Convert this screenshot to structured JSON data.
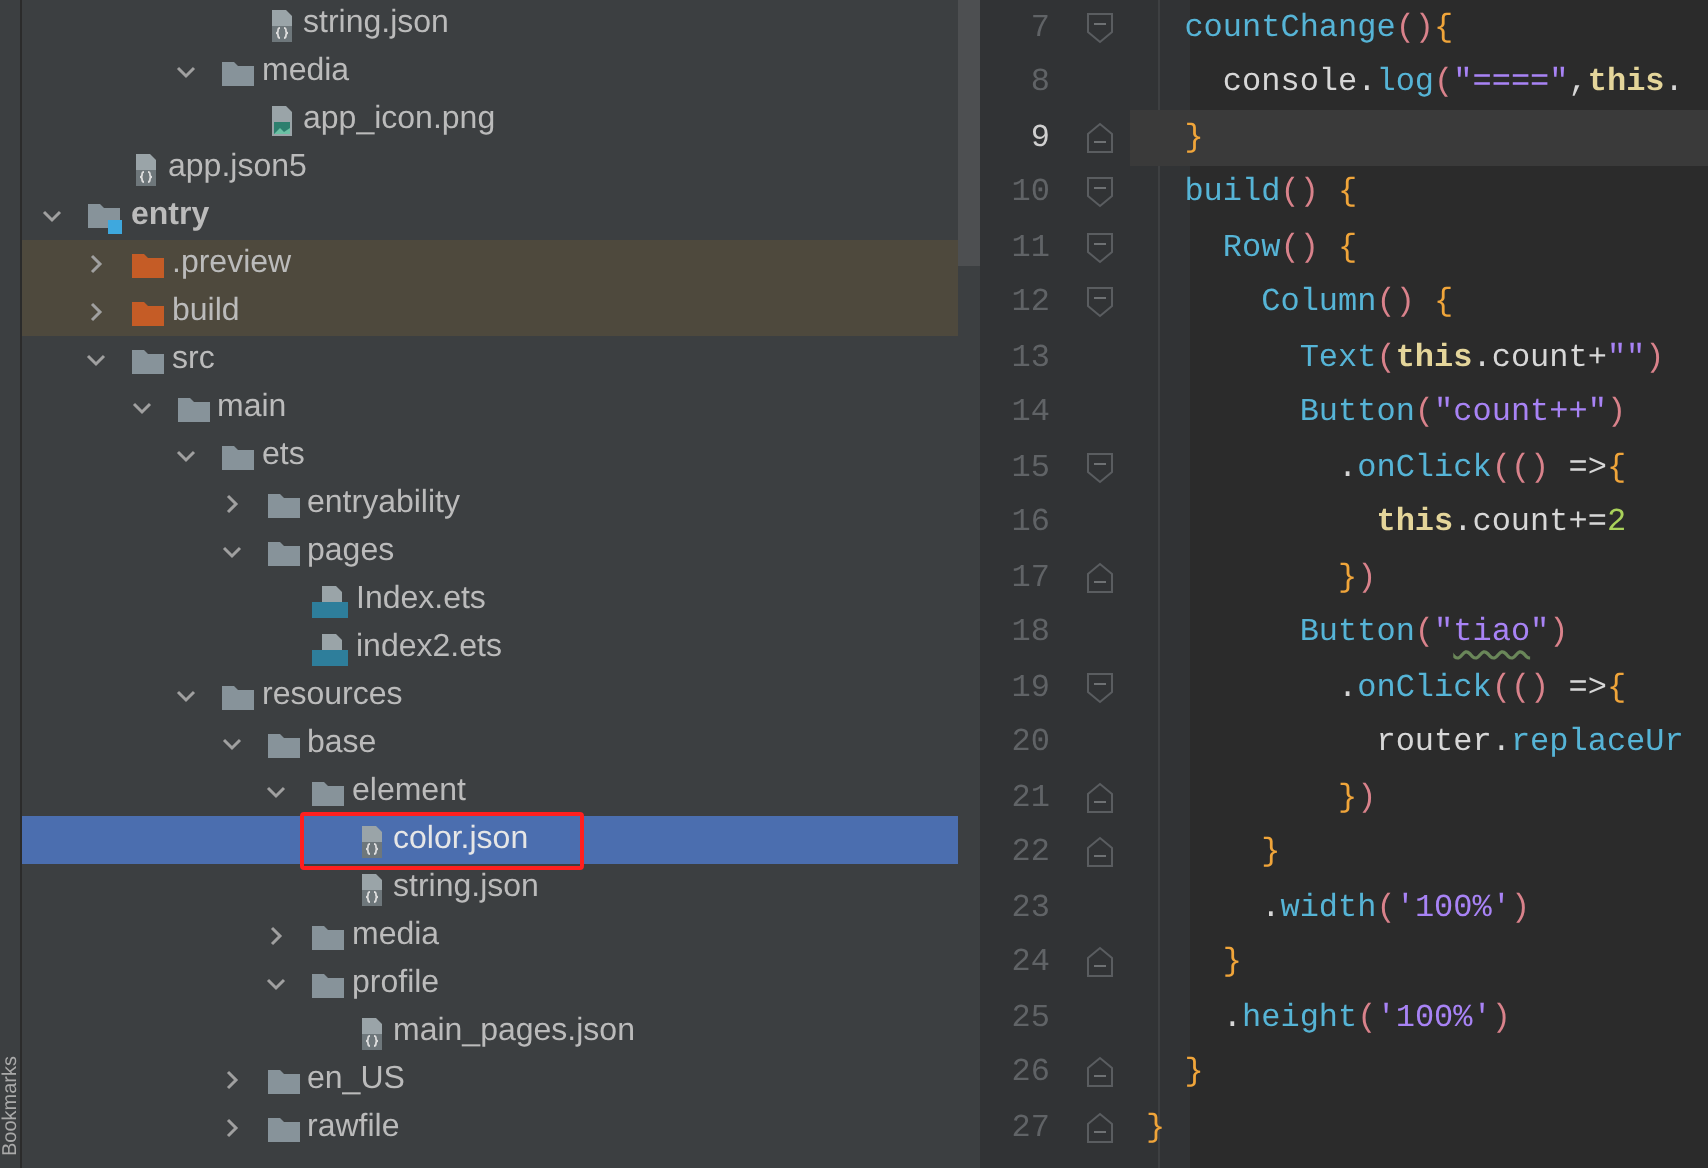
{
  "sidebar_strip": {
    "label": "Bookmarks"
  },
  "tree": [
    {
      "children": [
        {
          "children": [
            {
              "children": [
                {
                  "children": [
                    {
                      "label": "string.json",
                      "kind": "json",
                      "selected": false,
                      "annotated": false
                    }
                  ]
                },
                {
                  "label": "media",
                  "kind": "folder",
                  "expanded": true,
                  "selected": false,
                  "annotated": false,
                  "children": [
                    {
                      "label": "app_icon.png",
                      "kind": "image",
                      "selected": false,
                      "annotated": false
                    }
                  ]
                }
              ]
            }
          ]
        },
        {
          "label": "app.json5",
          "kind": "json",
          "selected": false,
          "annotated": false
        }
      ]
    },
    {
      "label": "entry",
      "kind": "module",
      "expanded": true,
      "selected": false,
      "annotated": false,
      "children": [
        {
          "label": ".preview",
          "kind": "excluded",
          "expanded": false,
          "selected": false,
          "annotated": false
        },
        {
          "label": "build",
          "kind": "excluded",
          "expanded": false,
          "selected": false,
          "annotated": false
        },
        {
          "label": "src",
          "kind": "folder",
          "expanded": true,
          "selected": false,
          "annotated": false,
          "children": [
            {
              "label": "main",
              "kind": "folder",
              "expanded": true,
              "selected": false,
              "annotated": false,
              "children": [
                {
                  "label": "ets",
                  "kind": "folder",
                  "expanded": true,
                  "selected": false,
                  "annotated": false,
                  "children": [
                    {
                      "label": "entryability",
                      "kind": "folder",
                      "expanded": false,
                      "selected": false,
                      "annotated": false
                    },
                    {
                      "label": "pages",
                      "kind": "folder",
                      "expanded": true,
                      "selected": false,
                      "annotated": false,
                      "children": [
                        {
                          "label": "Index.ets",
                          "kind": "ets",
                          "selected": false,
                          "annotated": false
                        },
                        {
                          "label": "index2.ets",
                          "kind": "ets",
                          "selected": false,
                          "annotated": false
                        }
                      ]
                    }
                  ]
                },
                {
                  "label": "resources",
                  "kind": "folder",
                  "expanded": true,
                  "selected": false,
                  "annotated": false,
                  "children": [
                    {
                      "label": "base",
                      "kind": "folder",
                      "expanded": true,
                      "selected": false,
                      "annotated": false,
                      "children": [
                        {
                          "label": "element",
                          "kind": "folder",
                          "expanded": true,
                          "selected": false,
                          "annotated": false,
                          "children": [
                            {
                              "label": "color.json",
                              "kind": "json",
                              "selected": true,
                              "annotated": true
                            },
                            {
                              "label": "string.json",
                              "kind": "json",
                              "selected": false,
                              "annotated": false
                            }
                          ]
                        },
                        {
                          "label": "media",
                          "kind": "folder",
                          "expanded": false,
                          "selected": false,
                          "annotated": false
                        },
                        {
                          "label": "profile",
                          "kind": "folder",
                          "expanded": true,
                          "selected": false,
                          "annotated": false,
                          "children": [
                            {
                              "label": "main_pages.json",
                              "kind": "json",
                              "selected": false,
                              "annotated": false
                            }
                          ]
                        }
                      ]
                    },
                    {
                      "label": "en_US",
                      "kind": "folder",
                      "expanded": false,
                      "selected": false,
                      "annotated": false
                    },
                    {
                      "label": "rawfile",
                      "kind": "folder",
                      "expanded": false,
                      "selected": false,
                      "annotated": false
                    }
                  ]
                }
              ]
            }
          ]
        }
      ]
    }
  ],
  "editor": {
    "lines": [
      {
        "number": "7",
        "current": false,
        "kind": "fold_start",
        "tokens": [
          {
            "text": "  countChange",
            "kind": "func"
          },
          {
            "text": "()",
            "kind": "paren"
          },
          {
            "text": "{",
            "kind": "brace"
          }
        ]
      },
      {
        "number": "8",
        "current": false,
        "kind": "plain",
        "tokens": [
          {
            "text": "    console.",
            "kind": "plain"
          },
          {
            "text": "log",
            "kind": "func"
          },
          {
            "text": "(",
            "kind": "paren"
          },
          {
            "text": "\"====\"",
            "kind": "string"
          },
          {
            "text": ",",
            "kind": "plain"
          },
          {
            "text": "this",
            "kind": "keyword"
          },
          {
            "text": ".",
            "kind": "plain"
          }
        ]
      },
      {
        "number": "9",
        "current": true,
        "kind": "fold_end",
        "tokens": [
          {
            "text": "  }",
            "kind": "brace"
          }
        ]
      },
      {
        "number": "10",
        "current": false,
        "kind": "fold_start",
        "tokens": [
          {
            "text": "  build",
            "kind": "func"
          },
          {
            "text": "()",
            "kind": "paren"
          },
          {
            "text": " {",
            "kind": "brace"
          }
        ]
      },
      {
        "number": "11",
        "current": false,
        "kind": "fold_start",
        "tokens": [
          {
            "text": "    Row",
            "kind": "func"
          },
          {
            "text": "()",
            "kind": "paren"
          },
          {
            "text": " {",
            "kind": "brace"
          }
        ]
      },
      {
        "number": "12",
        "current": false,
        "kind": "fold_start",
        "tokens": [
          {
            "text": "      Column",
            "kind": "func"
          },
          {
            "text": "()",
            "kind": "paren"
          },
          {
            "text": " {",
            "kind": "brace"
          }
        ]
      },
      {
        "number": "13",
        "current": false,
        "kind": "plain",
        "tokens": [
          {
            "text": "        Text",
            "kind": "func"
          },
          {
            "text": "(",
            "kind": "paren"
          },
          {
            "text": "this",
            "kind": "keyword"
          },
          {
            "text": ".count+",
            "kind": "plain"
          },
          {
            "text": "\"\"",
            "kind": "string"
          },
          {
            "text": ")",
            "kind": "paren"
          }
        ]
      },
      {
        "number": "14",
        "current": false,
        "kind": "plain",
        "tokens": [
          {
            "text": "        Button",
            "kind": "func"
          },
          {
            "text": "(",
            "kind": "paren"
          },
          {
            "text": "\"count++\"",
            "kind": "string"
          },
          {
            "text": ")",
            "kind": "paren"
          }
        ]
      },
      {
        "number": "15",
        "current": false,
        "kind": "fold_start",
        "tokens": [
          {
            "text": "          .",
            "kind": "plain"
          },
          {
            "text": "onClick",
            "kind": "func"
          },
          {
            "text": "(()",
            "kind": "paren"
          },
          {
            "text": " =>",
            "kind": "plain"
          },
          {
            "text": "{",
            "kind": "brace"
          }
        ]
      },
      {
        "number": "16",
        "current": false,
        "kind": "plain",
        "tokens": [
          {
            "text": "            this",
            "kind": "keyword"
          },
          {
            "text": ".count+=",
            "kind": "plain"
          },
          {
            "text": "2",
            "kind": "number"
          }
        ]
      },
      {
        "number": "17",
        "current": false,
        "kind": "fold_end",
        "tokens": [
          {
            "text": "          }",
            "kind": "brace"
          },
          {
            "text": ")",
            "kind": "paren"
          }
        ]
      },
      {
        "number": "18",
        "current": false,
        "kind": "plain",
        "tokens": [
          {
            "text": "        Button",
            "kind": "func"
          },
          {
            "text": "(",
            "kind": "paren"
          },
          {
            "text": "\"",
            "kind": "string"
          },
          {
            "text": "tiao",
            "kind": "string",
            "warning": true
          },
          {
            "text": "\"",
            "kind": "string"
          },
          {
            "text": ")",
            "kind": "paren"
          }
        ]
      },
      {
        "number": "19",
        "current": false,
        "kind": "fold_start",
        "tokens": [
          {
            "text": "          .",
            "kind": "plain"
          },
          {
            "text": "onClick",
            "kind": "func"
          },
          {
            "text": "(()",
            "kind": "paren"
          },
          {
            "text": " =>",
            "kind": "plain"
          },
          {
            "text": "{",
            "kind": "brace"
          }
        ]
      },
      {
        "number": "20",
        "current": false,
        "kind": "plain",
        "tokens": [
          {
            "text": "            router.",
            "kind": "plain"
          },
          {
            "text": "replaceUr",
            "kind": "func"
          }
        ]
      },
      {
        "number": "21",
        "current": false,
        "kind": "fold_end",
        "tokens": [
          {
            "text": "          }",
            "kind": "brace"
          },
          {
            "text": ")",
            "kind": "paren"
          }
        ]
      },
      {
        "number": "22",
        "current": false,
        "kind": "fold_end",
        "tokens": [
          {
            "text": "      }",
            "kind": "brace"
          }
        ]
      },
      {
        "number": "23",
        "current": false,
        "kind": "plain",
        "tokens": [
          {
            "text": "      .",
            "kind": "plain"
          },
          {
            "text": "width",
            "kind": "func"
          },
          {
            "text": "(",
            "kind": "paren"
          },
          {
            "text": "'100%'",
            "kind": "string"
          },
          {
            "text": ")",
            "kind": "paren"
          }
        ]
      },
      {
        "number": "24",
        "current": false,
        "kind": "fold_end",
        "tokens": [
          {
            "text": "    }",
            "kind": "brace"
          }
        ]
      },
      {
        "number": "25",
        "current": false,
        "kind": "plain",
        "tokens": [
          {
            "text": "    .",
            "kind": "plain"
          },
          {
            "text": "height",
            "kind": "func"
          },
          {
            "text": "(",
            "kind": "paren"
          },
          {
            "text": "'100%'",
            "kind": "string"
          },
          {
            "text": ")",
            "kind": "paren"
          }
        ]
      },
      {
        "number": "26",
        "current": false,
        "kind": "fold_end",
        "tokens": [
          {
            "text": "  }",
            "kind": "brace"
          }
        ]
      },
      {
        "number": "27",
        "current": false,
        "kind": "fold_end",
        "tokens": [
          {
            "text": "}",
            "kind": "brace"
          }
        ]
      }
    ]
  }
}
